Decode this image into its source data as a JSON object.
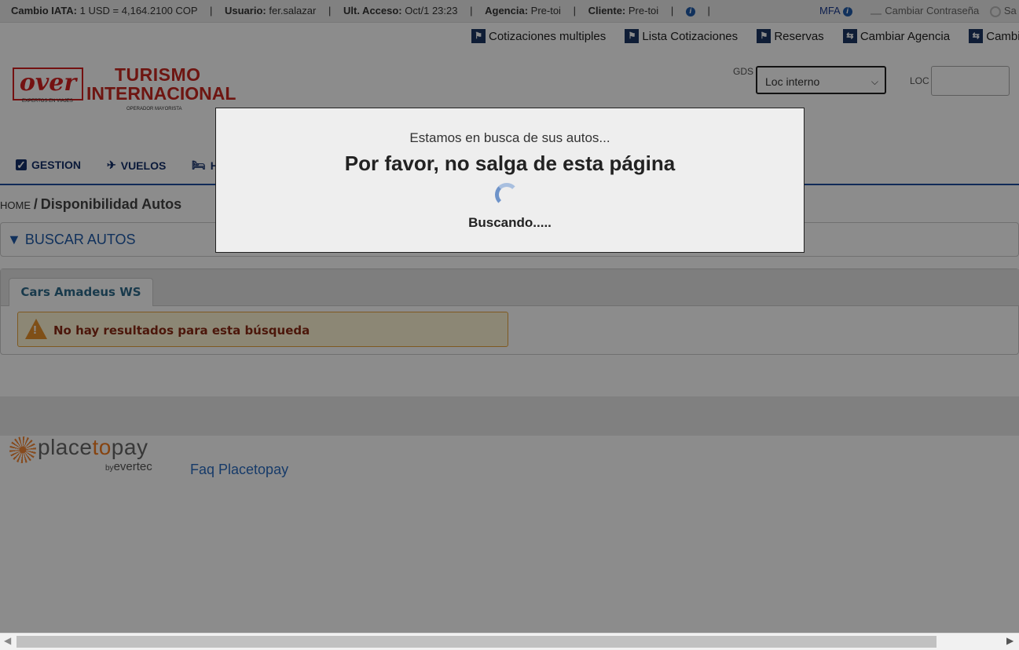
{
  "topbar": {
    "cambio_label": "Cambio IATA:",
    "cambio_value": "1 USD = 4,164.2100 COP",
    "usuario_label": "Usuario:",
    "usuario_value": "fer.salazar",
    "acceso_label": "Ult. Acceso:",
    "acceso_value": "Oct/1 23:23",
    "agencia_label": "Agencia:",
    "agencia_value": "Pre-toi",
    "cliente_label": "Cliente:",
    "cliente_value": "Pre-toi",
    "separator": "|",
    "mfa": "MFA",
    "cambiar_contrasena": "Cambiar Contraseña",
    "salir": "Sa"
  },
  "quicklinks": {
    "items": [
      {
        "label": "Cotizaciones multiples",
        "icon": "flag-icon"
      },
      {
        "label": "Lista Cotizaciones",
        "icon": "flag-icon"
      },
      {
        "label": "Reservas",
        "icon": "flag-icon"
      },
      {
        "label": "Cambiar Agencia",
        "icon": "swap-icon"
      },
      {
        "label": "Cambia",
        "icon": "swap-icon"
      }
    ]
  },
  "logo": {
    "over": "over",
    "over_sub": "EXPERTOS EN VIAJES",
    "line1": "TURISMO",
    "line2": "INTERNACIONAL",
    "line3": "OPERADOR MAYORISTA"
  },
  "form": {
    "gds_label": "GDS",
    "gds_value": "Loc interno",
    "loc_label": "LOC",
    "loc_value": ""
  },
  "nav": {
    "items": [
      {
        "label": "GESTION",
        "icon": "checkbox-icon"
      },
      {
        "label": "VUELOS",
        "icon": "plane-icon"
      },
      {
        "label": "H",
        "icon": "bed-icon"
      }
    ]
  },
  "breadcrumb": {
    "home": "HOME",
    "sep": "/",
    "current": "Disponibilidad Autos"
  },
  "search_panel": {
    "arrow": "▼",
    "label": "BUSCAR AUTOS"
  },
  "results": {
    "tab": "Cars Amadeus WS",
    "alert": "No hay resultados para esta búsqueda"
  },
  "footer": {
    "ptp_place": "place",
    "ptp_to": "to",
    "ptp_pay": "pay",
    "ptp_by": "by",
    "ptp_evertec": "evertec",
    "faq": "Faq Placetopay"
  },
  "modal": {
    "subtitle": "Estamos en busca de sus autos...",
    "title": "Por favor, no salga de esta página",
    "status": "Buscando....."
  },
  "colors": {
    "nav_text": "#15306b",
    "accent_blue": "#1f5aa8",
    "brand_red": "#c8271f",
    "alert_bg": "#fff6d6",
    "alert_border": "#e8a33d",
    "overlay": "rgba(0,0,0,0.45)"
  }
}
